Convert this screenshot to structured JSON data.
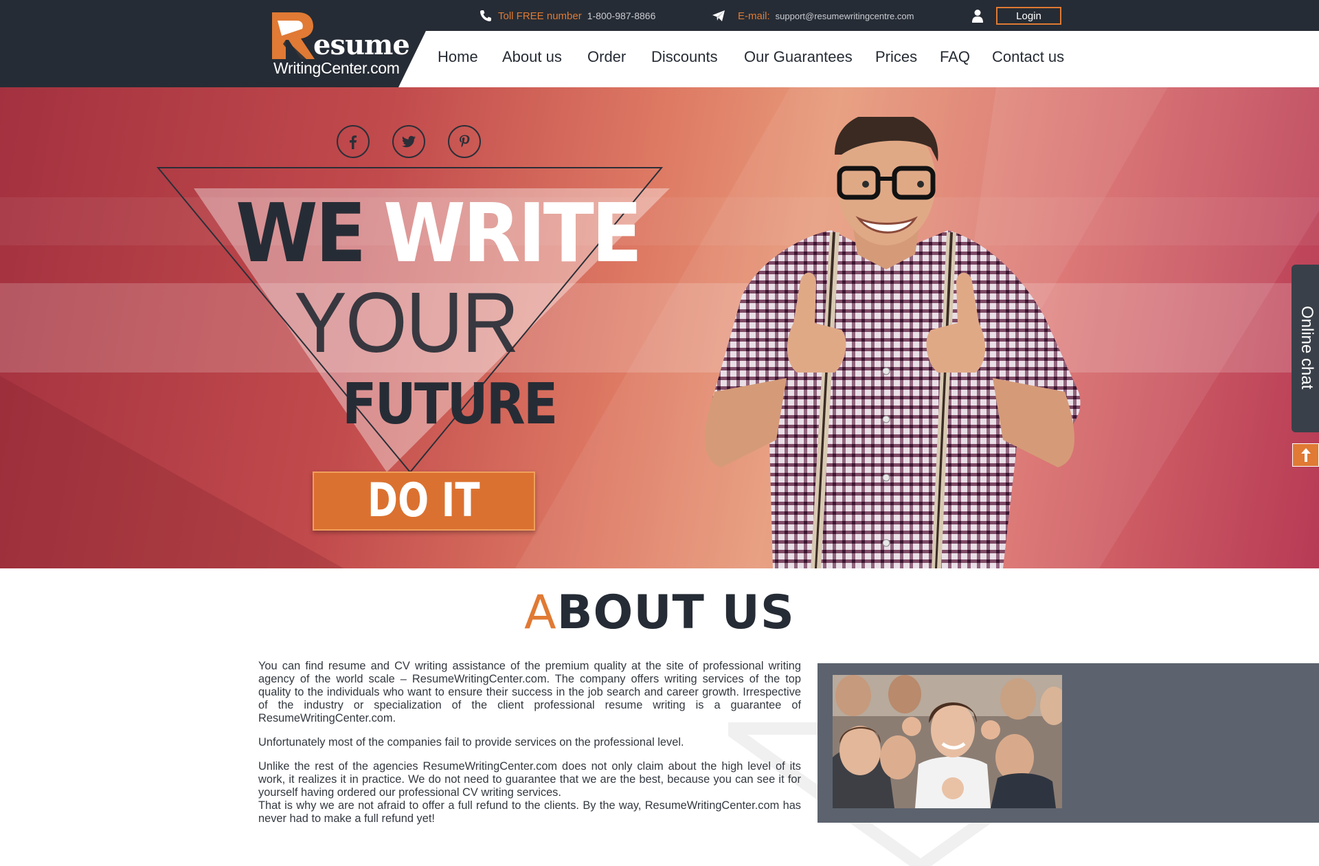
{
  "topbar": {
    "phone_label": "Toll FREE number",
    "phone_value": "1-800-987-8866",
    "email_label": "E-mail:",
    "email_value": "support@resumewritingcentre.com",
    "login_label": "Login"
  },
  "logo": {
    "word": "esume",
    "sub": "WritingCenter.com"
  },
  "nav": [
    {
      "label": "Home"
    },
    {
      "label": "About us"
    },
    {
      "label": "Order"
    },
    {
      "label": "Discounts"
    },
    {
      "label": "Our Guarantees"
    },
    {
      "label": "Prices"
    },
    {
      "label": "FAQ"
    },
    {
      "label": "Contact us"
    }
  ],
  "hero": {
    "line1a": "WE",
    "line1b": "WRITE",
    "line2": "YOUR",
    "line3": "FUTURE",
    "cta": "DO IT"
  },
  "side": {
    "chat_label": "Online chat"
  },
  "about": {
    "title_first": "A",
    "title_rest": "BOUT US",
    "p1": "You can find resume and CV writing assistance of the premium quality at the site of professional writing agency of the world scale – ResumeWritingCenter.com. The company offers writing services of the top quality to the individuals who want to ensure their success in the job search and career growth. Irrespective of the industry or specialization of the client professional resume writing is a guarantee of ResumeWritingCenter.com.",
    "p2": "Unfortunately most of the companies fail to provide services on the professional level.",
    "p3": "Unlike the rest of the agencies ResumeWritingCenter.com does not only claim about the high level of its work, it realizes it in practice. We do not need to guarantee that we are the best, because you can see it for yourself having ordered our professional CV writing services.",
    "p4": "That is why we are not afraid to offer a full refund to the clients. By the way, ResumeWritingCenter.com has never had to make a full refund yet!"
  },
  "colors": {
    "dark": "#262c35",
    "accent": "#e07a34",
    "hero_red": "#c14a4c",
    "gray_box": "#5c636e"
  },
  "icons": [
    "phone-icon",
    "paper-plane-icon",
    "user-icon",
    "facebook-icon",
    "twitter-icon",
    "pinterest-icon",
    "arrow-up-icon"
  ]
}
